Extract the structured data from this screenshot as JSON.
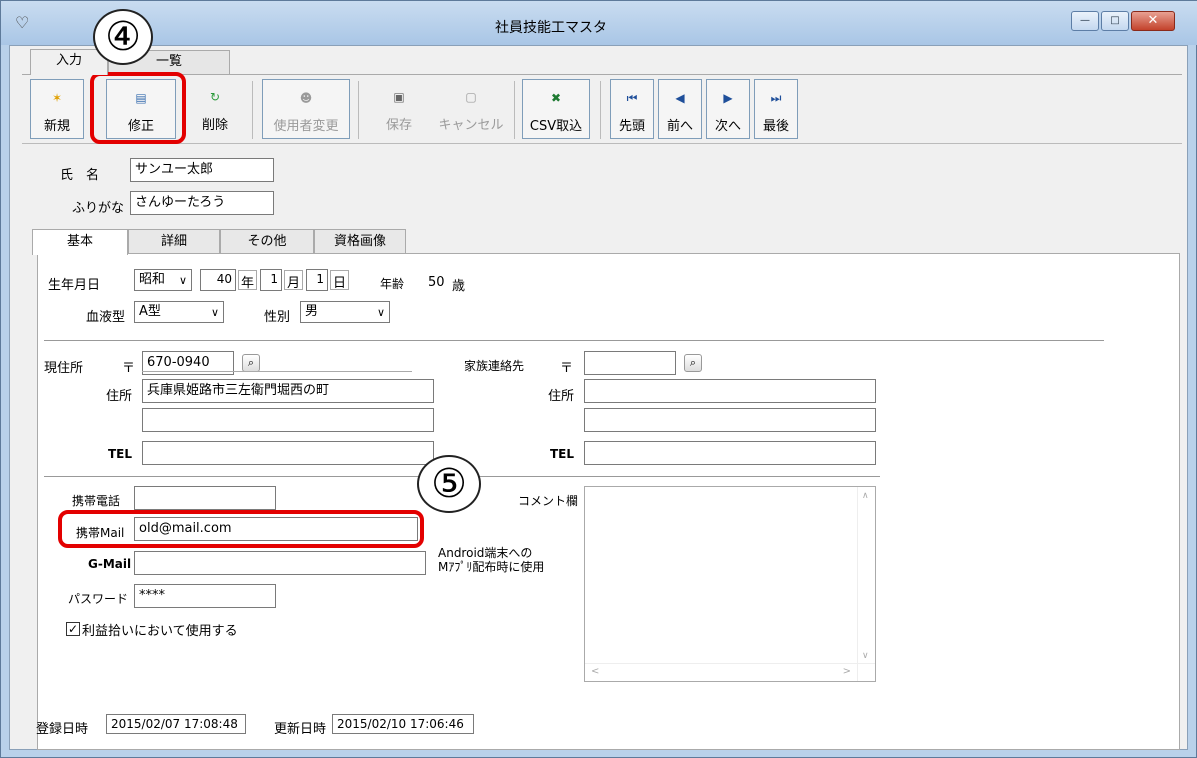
{
  "window": {
    "title": "社員技能工マスタ",
    "controls": {
      "minimize": "—",
      "maximize": "□",
      "close": "✕"
    }
  },
  "top_tabs": [
    "入力",
    "一覧"
  ],
  "toolbar": {
    "new": "新規",
    "edit": "修正",
    "delete": "削除",
    "change_user": "使用者変更",
    "save": "保存",
    "cancel": "キャンセル",
    "csv_import": "CSV取込",
    "first": "先頭",
    "prev": "前へ",
    "next": "次へ",
    "last": "最後"
  },
  "annotations": {
    "step4": "④",
    "step5": "⑤"
  },
  "header": {
    "name_label": "氏　名",
    "name_value": "サンユー太郎",
    "furigana_label": "ふりがな",
    "furigana_value": "さんゆーたろう"
  },
  "inner_tabs": [
    "基本",
    "詳細",
    "その他",
    "資格画像"
  ],
  "basic": {
    "birth_label": "生年月日",
    "era_value": "昭和",
    "year_value": "40",
    "year_unit": "年",
    "month_value": "1",
    "month_unit": "月",
    "day_value": "1",
    "day_unit": "日",
    "age_label": "年齢",
    "age_value": "50",
    "age_unit": "歳",
    "blood_label": "血液型",
    "blood_value": "A型",
    "gender_label": "性別",
    "gender_value": "男"
  },
  "address": {
    "current_label": "現住所",
    "postal_mark": "〒",
    "postal_value": "670-0940",
    "addr_label": "住所",
    "addr_value": "兵庫県姫路市三左衛門堀西の町",
    "addr2_value": "",
    "tel_label": "TEL",
    "tel_value": "",
    "family_label": "家族連絡先",
    "family_postal_value": "",
    "family_addr_value": "",
    "family_addr2_value": "",
    "family_tel_value": ""
  },
  "contact": {
    "mobile_label": "携帯電話",
    "mobile_value": "",
    "mail_label": "携帯Mail",
    "mail_value": "old@mail.com",
    "gmail_label": "G-Mail",
    "gmail_value": "",
    "gmail_note_1": "Android端末への",
    "gmail_note_2": "Mｱﾌﾟﾘ配布時に使用",
    "password_label": "パスワード",
    "password_value": "****",
    "profit_check_label": "利益拾いにおいて使用する",
    "profit_checked": "✓",
    "comment_label": "コメント欄"
  },
  "footer": {
    "registered_label": "登録日時",
    "registered_value": "2015/02/07 17:08:48",
    "updated_label": "更新日時",
    "updated_value": "2015/02/10 17:06:46"
  },
  "colors": {
    "highlight": "#e30000",
    "window_frame": "#b9d1ea"
  }
}
